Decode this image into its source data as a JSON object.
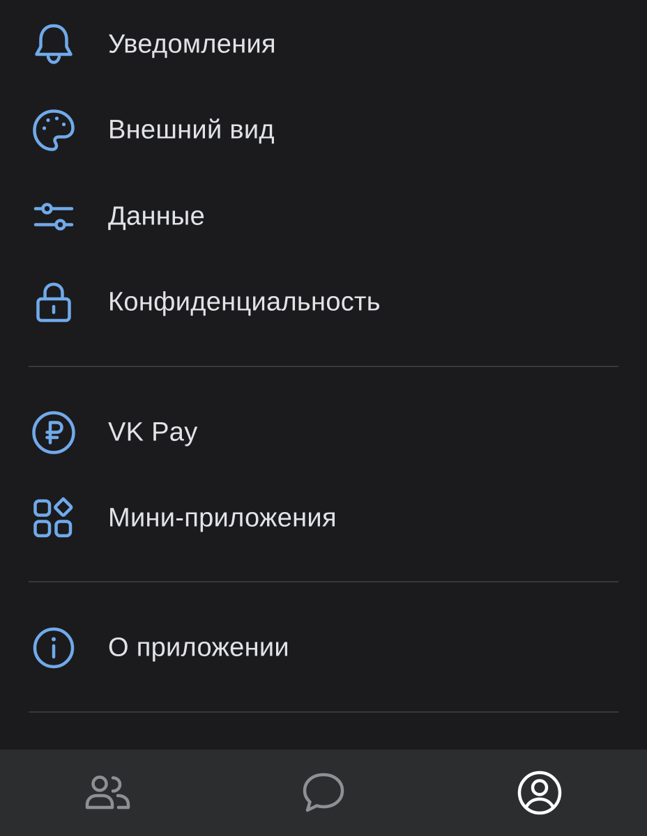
{
  "menu": {
    "items": [
      {
        "label": "Уведомления",
        "icon": "bell-icon"
      },
      {
        "label": "Внешний вид",
        "icon": "palette-icon"
      },
      {
        "label": "Данные",
        "icon": "sliders-icon"
      },
      {
        "label": "Конфиденциальность",
        "icon": "lock-icon"
      },
      {
        "label": "VK Pay",
        "icon": "ruble-circle-icon"
      },
      {
        "label": "Мини-приложения",
        "icon": "apps-grid-icon"
      },
      {
        "label": "О приложении",
        "icon": "info-icon"
      }
    ]
  },
  "tabbar": {
    "tabs": [
      {
        "icon": "users-icon",
        "active": false
      },
      {
        "icon": "chat-bubble-icon",
        "active": false
      },
      {
        "icon": "profile-icon",
        "active": true
      }
    ]
  },
  "colors": {
    "background": "#1b1b1d",
    "accent": "#71aaeb",
    "text": "#e1e3e6",
    "separator": "#38393c",
    "tabbar_bg": "#2c2d2f",
    "tab_inactive": "#8e9093",
    "tab_active": "#ffffff"
  }
}
